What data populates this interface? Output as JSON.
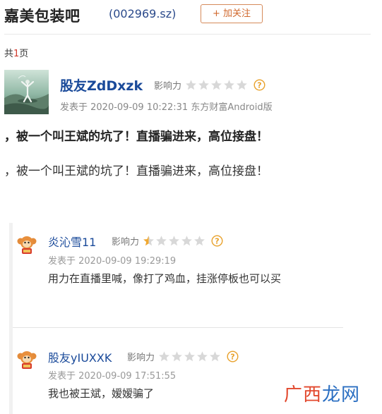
{
  "header": {
    "bar_name": "嘉美包装吧",
    "stock_code": "(002969.sz)",
    "follow_label": "+ 加关注"
  },
  "pagination": {
    "prefix": "共",
    "count": "1",
    "suffix": "页"
  },
  "post": {
    "author": "股友ZdDxzk",
    "influence_label": "影响力",
    "influence_stars": 0,
    "meta": "发表于 2020-09-09 10:22:31 东方财富Android版",
    "title": "，被一个叫王斌的坑了！直播骗进来，高位接盘！",
    "body": "，被一个叫王斌的坑了！直播骗进来，高位接盘！"
  },
  "replies": [
    {
      "author": "炎沁雪11",
      "influence_label": "影响力",
      "influence_stars": 0.5,
      "time": "发表于 2020-09-09 19:29:19",
      "text": "用力在直播里喊，像打了鸡血，挂涨停板也可以买"
    },
    {
      "author": "股友yIUXXK",
      "influence_label": "影响力",
      "influence_stars": 0,
      "time": "发表于 2020-09-09 17:51:55",
      "text": "我也被王斌，嫒嫒骗了"
    }
  ],
  "watermark": {
    "part1": "广西",
    "part2": "龙网"
  },
  "colors": {
    "link_blue": "#1a4a9a",
    "star_filled": "#f0a830",
    "star_empty": "#d8d8d8",
    "follow_orange": "#d0682c"
  },
  "icons": {
    "help": "question-circle-icon",
    "star": "star-icon",
    "avatar_reply": "monkey-avatar-icon"
  }
}
